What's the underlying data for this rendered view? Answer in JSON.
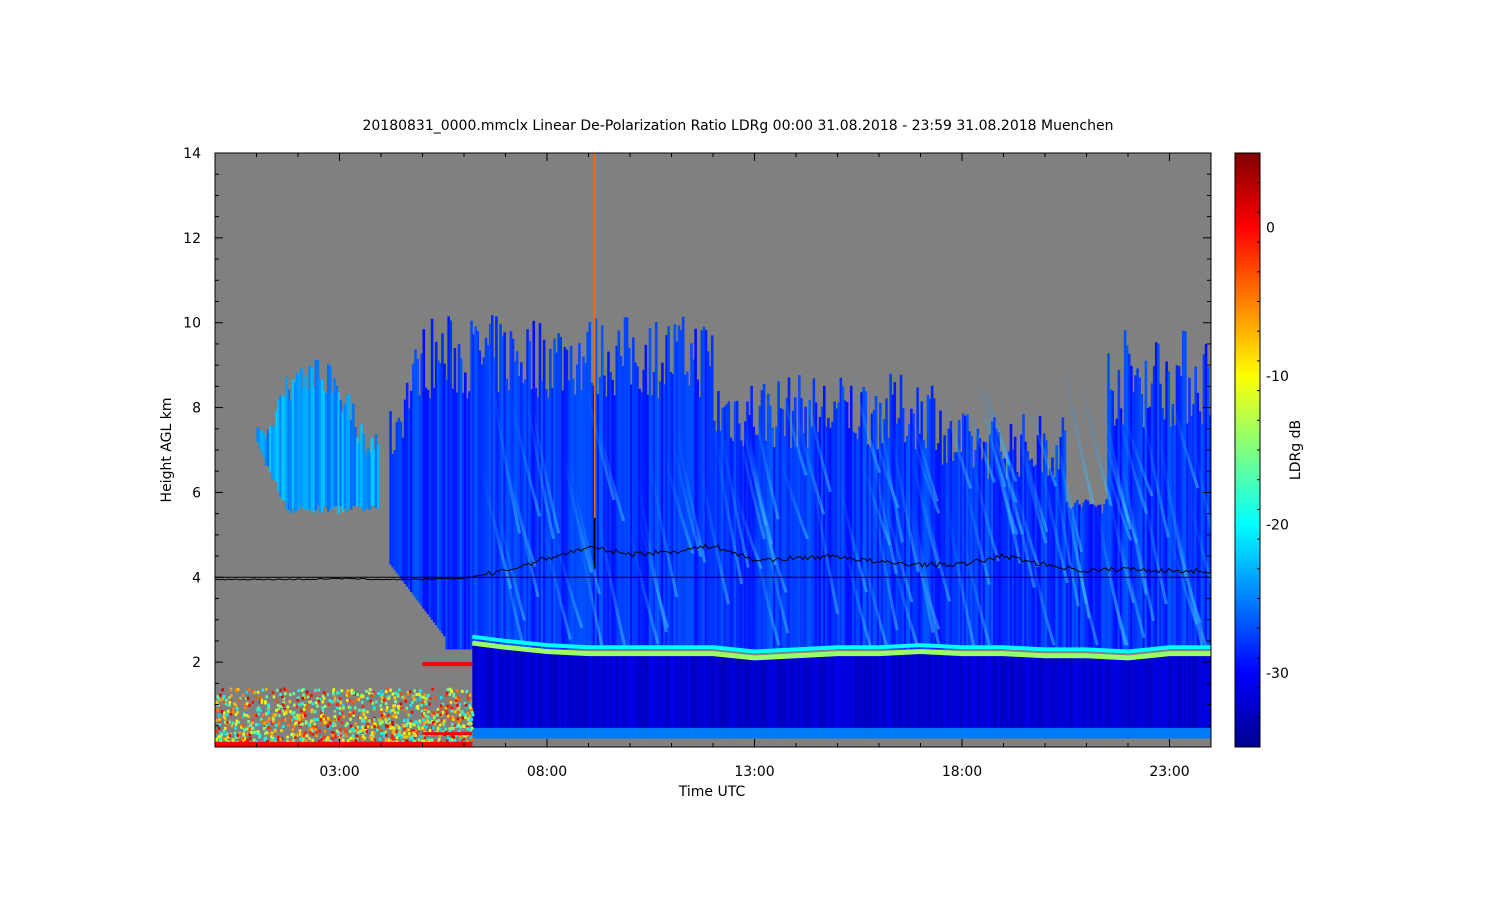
{
  "chart_data": {
    "type": "heatmap",
    "title": "20180831_0000.mmclx Linear De-Polarization Ratio LDRg   00:00 31.08.2018 - 23:59 31.08.2018 Muenchen",
    "xlabel": "Time UTC",
    "ylabel": "Height AGL km",
    "colorbar_label": "LDRg dB",
    "x_range_hours": [
      0,
      24
    ],
    "y_range_km": [
      0,
      14
    ],
    "x_ticks": [
      {
        "value": 3,
        "label": "03:00"
      },
      {
        "value": 8,
        "label": "08:00"
      },
      {
        "value": 13,
        "label": "13:00"
      },
      {
        "value": 18,
        "label": "18:00"
      },
      {
        "value": 23,
        "label": "23:00"
      }
    ],
    "y_ticks": [
      {
        "value": 2,
        "label": "2"
      },
      {
        "value": 4,
        "label": "4"
      },
      {
        "value": 6,
        "label": "6"
      },
      {
        "value": 8,
        "label": "8"
      },
      {
        "value": 10,
        "label": "10"
      },
      {
        "value": 12,
        "label": "12"
      },
      {
        "value": 14,
        "label": "14"
      }
    ],
    "colorbar_range_db": [
      -35,
      5
    ],
    "colorbar_ticks": [
      {
        "value": 0,
        "label": "0"
      },
      {
        "value": -10,
        "label": "-10"
      },
      {
        "value": -20,
        "label": "-20"
      },
      {
        "value": -30,
        "label": "-30"
      }
    ],
    "colormap": [
      "#00008f",
      "#0000ff",
      "#0080ff",
      "#00ffff",
      "#80ff80",
      "#ffff00",
      "#ff8000",
      "#ff0000",
      "#800000"
    ],
    "background_color": "#808080",
    "reference_line_km": 4.0,
    "melting_layer": {
      "times": [
        6.2,
        7,
        8,
        9,
        10,
        11,
        12,
        13,
        14,
        15,
        16,
        17,
        18,
        19,
        20,
        21,
        22,
        23,
        24
      ],
      "height_km": [
        2.45,
        2.35,
        2.25,
        2.2,
        2.2,
        2.2,
        2.2,
        2.1,
        2.15,
        2.2,
        2.2,
        2.25,
        2.2,
        2.2,
        2.15,
        2.15,
        2.1,
        2.2,
        2.2
      ],
      "ldr_db": -14
    },
    "black_trace": {
      "times": [
        0,
        1,
        2,
        3,
        4,
        5,
        6,
        7,
        8,
        9,
        10,
        11,
        12,
        13,
        14,
        15,
        16,
        17,
        18,
        19,
        20,
        21,
        22,
        23,
        24
      ],
      "height_km": [
        3.95,
        3.95,
        3.95,
        3.97,
        3.95,
        3.95,
        3.98,
        4.15,
        4.45,
        4.7,
        4.55,
        4.6,
        4.75,
        4.4,
        4.45,
        4.5,
        4.35,
        4.3,
        4.3,
        4.5,
        4.3,
        4.15,
        4.2,
        4.15,
        4.15
      ]
    },
    "regions": [
      {
        "name": "upper-cloud",
        "t_start": 1.0,
        "t_end": 3.9,
        "base_km": 5.5,
        "top_km": 9.2,
        "ldr_db": -24
      },
      {
        "name": "precip-cloud",
        "t_start": 4.2,
        "t_end": 24.0,
        "base_km": 2.3,
        "top_km": 10.3,
        "ldr_db": -28
      },
      {
        "name": "rain-layer",
        "t_start": 6.2,
        "t_end": 24.0,
        "base_km": 0.2,
        "top_km": 2.1,
        "ldr_db": -32
      },
      {
        "name": "near-ground-clutter",
        "t_start": 0.0,
        "t_end": 6.2,
        "base_km": 0.0,
        "top_km": 1.4,
        "ldr_db": -10
      }
    ]
  }
}
